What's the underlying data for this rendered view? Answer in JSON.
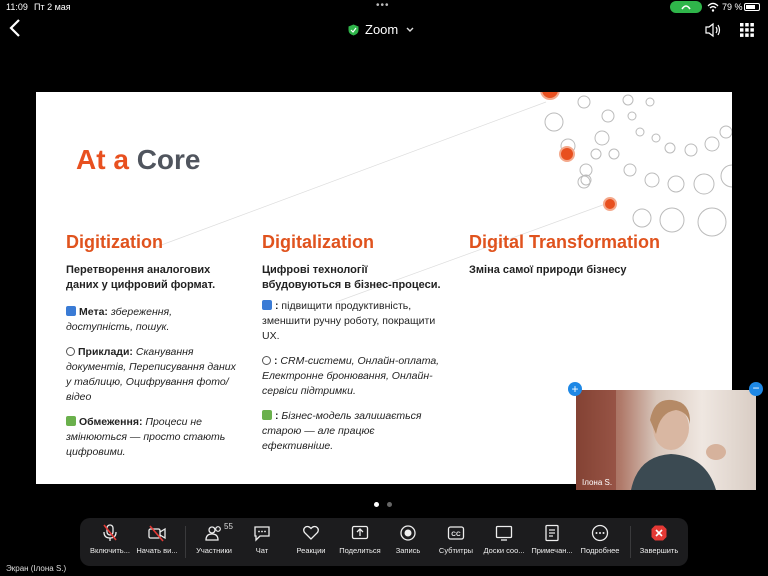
{
  "status_bar": {
    "time": "11:09",
    "date": "Пт 2 мая",
    "battery_percent": "79 %",
    "battery_level": 0.79,
    "call_indicator_color": "#2fb54a"
  },
  "header": {
    "app_title": "Zoom",
    "icons": [
      "back-icon",
      "shield-icon",
      "chevron-down-icon",
      "speaker-icon",
      "grid-icon"
    ]
  },
  "slide": {
    "title_part1": "At a",
    "title_part2": "Core",
    "columns": [
      {
        "heading": "Digitization",
        "subtitle": "Перетворення аналогових даних у цифровий формат.",
        "items": [
          {
            "icon": "arrow-right-icon",
            "label": "Мета:",
            "text": "збереження, доступність, пошук."
          },
          {
            "icon": "search-icon",
            "label": "Приклади:",
            "text": "Сканування документів, Переписування даних у таблицю, Оцифрування фото/відео"
          },
          {
            "icon": "puzzle-icon",
            "label": "Обмеження:",
            "text": "Процеси не змінюються — просто стають цифровими."
          }
        ]
      },
      {
        "heading": "Digitalization",
        "subtitle": "Цифрові технології вбудовуються в бізнес-процеси.",
        "items": [
          {
            "icon": "arrow-right-icon",
            "label": ":",
            "text": "підвищити продуктивність, зменшити ручну роботу, покращити UX."
          },
          {
            "icon": "search-icon",
            "label": ":",
            "text": "CRM-системи, Онлайн-оплата, Електронне бронювання, Онлайн-сервіси підтримки."
          },
          {
            "icon": "puzzle-icon",
            "label": ":",
            "text": "Бізнес-модель залишається старою — але працює ефективніше."
          }
        ]
      },
      {
        "heading": "Digital Transformation",
        "subtitle": "Зміна самої природи бізнесу",
        "items": []
      }
    ],
    "accent_color": "#e0531e"
  },
  "video": {
    "participant_name": "Ілона S."
  },
  "pager": {
    "pages": 2,
    "current": 1
  },
  "toolbar": {
    "items": [
      {
        "label": "Включить...",
        "icon": "microphone-muted-icon"
      },
      {
        "label": "Начать ви...",
        "icon": "video-off-icon"
      },
      {
        "label": "Участники",
        "icon": "participants-icon",
        "count": "55"
      },
      {
        "label": "Чат",
        "icon": "chat-icon"
      },
      {
        "label": "Реакции",
        "icon": "heart-icon"
      },
      {
        "label": "Поделиться",
        "icon": "share-icon"
      },
      {
        "label": "Запись",
        "icon": "record-icon"
      },
      {
        "label": "Субтитры",
        "icon": "cc-icon"
      },
      {
        "label": "Доски соо...",
        "icon": "whiteboard-icon"
      },
      {
        "label": "Примечан...",
        "icon": "notes-icon"
      },
      {
        "label": "Подробнее",
        "icon": "more-icon"
      },
      {
        "label": "Завершить",
        "icon": "end-icon"
      }
    ]
  },
  "screen_label": "Экран (Ілона S.)"
}
